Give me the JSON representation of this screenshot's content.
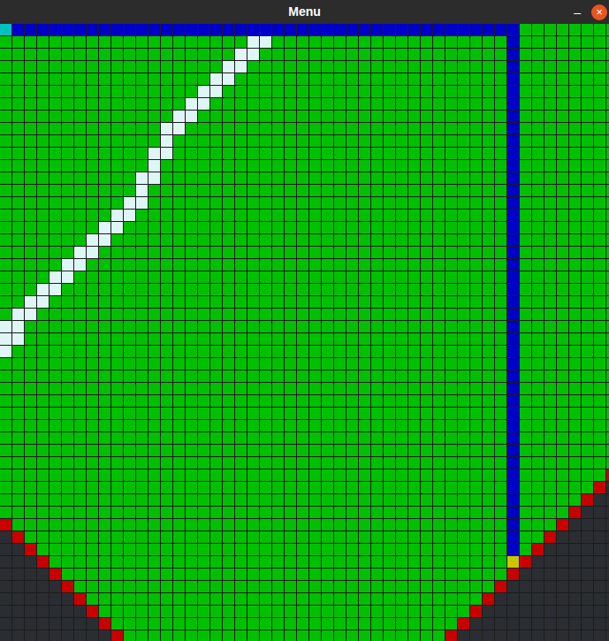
{
  "window": {
    "title": "Menu",
    "controls": [
      "–",
      "×"
    ]
  },
  "cell_kinds": [
    {
      "symbol": "S",
      "kind": "start",
      "color": "#00c0c0"
    },
    {
      "symbol": "E",
      "kind": "goal",
      "color": "#c8c800"
    },
    {
      "symbol": "G",
      "kind": "open",
      "color": "#00c000"
    },
    {
      "symbol": "B",
      "kind": "path",
      "color": "#0000c8"
    },
    {
      "symbol": "W",
      "kind": "wall",
      "color": "#dff6f6"
    },
    {
      "symbol": "R",
      "kind": "edge",
      "color": "#c80000"
    },
    {
      "symbol": "D",
      "kind": "void",
      "color": "#2a2e32"
    }
  ],
  "grid": {
    "rows": [
      [
        [
          "S",
          1
        ],
        [
          "B",
          41
        ],
        [
          "G",
          8
        ]
      ],
      [
        [
          "G",
          20
        ],
        [
          "W",
          2
        ],
        [
          "G",
          19
        ],
        [
          "B",
          1
        ],
        [
          "G",
          8
        ]
      ],
      [
        [
          "G",
          19
        ],
        [
          "W",
          2
        ],
        [
          "G",
          20
        ],
        [
          "B",
          1
        ],
        [
          "G",
          8
        ]
      ],
      [
        [
          "G",
          18
        ],
        [
          "W",
          2
        ],
        [
          "G",
          21
        ],
        [
          "B",
          1
        ],
        [
          "G",
          8
        ]
      ],
      [
        [
          "G",
          17
        ],
        [
          "W",
          2
        ],
        [
          "G",
          22
        ],
        [
          "B",
          1
        ],
        [
          "G",
          8
        ]
      ],
      [
        [
          "G",
          16
        ],
        [
          "W",
          2
        ],
        [
          "G",
          23
        ],
        [
          "B",
          1
        ],
        [
          "G",
          8
        ]
      ],
      [
        [
          "G",
          15
        ],
        [
          "W",
          2
        ],
        [
          "G",
          24
        ],
        [
          "B",
          1
        ],
        [
          "G",
          8
        ]
      ],
      [
        [
          "G",
          14
        ],
        [
          "W",
          2
        ],
        [
          "G",
          25
        ],
        [
          "B",
          1
        ],
        [
          "G",
          8
        ]
      ],
      [
        [
          "G",
          13
        ],
        [
          "W",
          2
        ],
        [
          "G",
          26
        ],
        [
          "B",
          1
        ],
        [
          "G",
          8
        ]
      ],
      [
        [
          "G",
          13
        ],
        [
          "W",
          1
        ],
        [
          "G",
          27
        ],
        [
          "B",
          1
        ],
        [
          "G",
          8
        ]
      ],
      [
        [
          "G",
          12
        ],
        [
          "W",
          2
        ],
        [
          "G",
          27
        ],
        [
          "B",
          1
        ],
        [
          "G",
          8
        ]
      ],
      [
        [
          "G",
          12
        ],
        [
          "W",
          1
        ],
        [
          "G",
          28
        ],
        [
          "B",
          1
        ],
        [
          "G",
          8
        ]
      ],
      [
        [
          "G",
          11
        ],
        [
          "W",
          2
        ],
        [
          "G",
          28
        ],
        [
          "B",
          1
        ],
        [
          "G",
          8
        ]
      ],
      [
        [
          "G",
          11
        ],
        [
          "W",
          1
        ],
        [
          "G",
          29
        ],
        [
          "B",
          1
        ],
        [
          "G",
          8
        ]
      ],
      [
        [
          "G",
          10
        ],
        [
          "W",
          2
        ],
        [
          "G",
          29
        ],
        [
          "B",
          1
        ],
        [
          "G",
          8
        ]
      ],
      [
        [
          "G",
          9
        ],
        [
          "W",
          2
        ],
        [
          "G",
          30
        ],
        [
          "B",
          1
        ],
        [
          "G",
          8
        ]
      ],
      [
        [
          "G",
          8
        ],
        [
          "W",
          2
        ],
        [
          "G",
          31
        ],
        [
          "B",
          1
        ],
        [
          "G",
          8
        ]
      ],
      [
        [
          "G",
          7
        ],
        [
          "W",
          2
        ],
        [
          "G",
          32
        ],
        [
          "B",
          1
        ],
        [
          "G",
          8
        ]
      ],
      [
        [
          "G",
          6
        ],
        [
          "W",
          2
        ],
        [
          "G",
          33
        ],
        [
          "B",
          1
        ],
        [
          "G",
          8
        ]
      ],
      [
        [
          "G",
          5
        ],
        [
          "W",
          2
        ],
        [
          "G",
          34
        ],
        [
          "B",
          1
        ],
        [
          "G",
          8
        ]
      ],
      [
        [
          "G",
          4
        ],
        [
          "W",
          2
        ],
        [
          "G",
          35
        ],
        [
          "B",
          1
        ],
        [
          "G",
          8
        ]
      ],
      [
        [
          "G",
          3
        ],
        [
          "W",
          2
        ],
        [
          "G",
          36
        ],
        [
          "B",
          1
        ],
        [
          "G",
          8
        ]
      ],
      [
        [
          "G",
          2
        ],
        [
          "W",
          2
        ],
        [
          "G",
          37
        ],
        [
          "B",
          1
        ],
        [
          "G",
          8
        ]
      ],
      [
        [
          "G",
          1
        ],
        [
          "W",
          2
        ],
        [
          "G",
          38
        ],
        [
          "B",
          1
        ],
        [
          "G",
          8
        ]
      ],
      [
        [
          "W",
          2
        ],
        [
          "G",
          39
        ],
        [
          "B",
          1
        ],
        [
          "G",
          8
        ]
      ],
      [
        [
          "W",
          2
        ],
        [
          "G",
          39
        ],
        [
          "B",
          1
        ],
        [
          "G",
          8
        ]
      ],
      [
        [
          "W",
          1
        ],
        [
          "G",
          40
        ],
        [
          "B",
          1
        ],
        [
          "G",
          8
        ]
      ],
      [
        [
          "G",
          41
        ],
        [
          "B",
          1
        ],
        [
          "G",
          8
        ]
      ],
      [
        [
          "G",
          41
        ],
        [
          "B",
          1
        ],
        [
          "G",
          8
        ]
      ],
      [
        [
          "G",
          41
        ],
        [
          "B",
          1
        ],
        [
          "G",
          8
        ]
      ],
      [
        [
          "G",
          41
        ],
        [
          "B",
          1
        ],
        [
          "G",
          8
        ]
      ],
      [
        [
          "G",
          41
        ],
        [
          "B",
          1
        ],
        [
          "G",
          8
        ]
      ],
      [
        [
          "G",
          41
        ],
        [
          "B",
          1
        ],
        [
          "G",
          8
        ]
      ],
      [
        [
          "G",
          41
        ],
        [
          "B",
          1
        ],
        [
          "G",
          8
        ]
      ],
      [
        [
          "G",
          41
        ],
        [
          "B",
          1
        ],
        [
          "G",
          8
        ]
      ],
      [
        [
          "G",
          41
        ],
        [
          "B",
          1
        ],
        [
          "G",
          8
        ]
      ],
      [
        [
          "G",
          41
        ],
        [
          "B",
          1
        ],
        [
          "G",
          7
        ],
        [
          "R",
          1
        ]
      ],
      [
        [
          "G",
          41
        ],
        [
          "B",
          1
        ],
        [
          "G",
          6
        ],
        [
          "R",
          1
        ],
        [
          "D",
          1
        ]
      ],
      [
        [
          "G",
          41
        ],
        [
          "B",
          1
        ],
        [
          "G",
          5
        ],
        [
          "R",
          1
        ],
        [
          "D",
          2
        ]
      ],
      [
        [
          "G",
          41
        ],
        [
          "B",
          1
        ],
        [
          "G",
          4
        ],
        [
          "R",
          1
        ],
        [
          "D",
          3
        ]
      ],
      [
        [
          "R",
          1
        ],
        [
          "G",
          40
        ],
        [
          "B",
          1
        ],
        [
          "G",
          3
        ],
        [
          "R",
          1
        ],
        [
          "D",
          4
        ]
      ],
      [
        [
          "D",
          1
        ],
        [
          "R",
          1
        ],
        [
          "G",
          39
        ],
        [
          "B",
          1
        ],
        [
          "G",
          2
        ],
        [
          "R",
          1
        ],
        [
          "D",
          5
        ]
      ],
      [
        [
          "D",
          2
        ],
        [
          "R",
          1
        ],
        [
          "G",
          38
        ],
        [
          "B",
          1
        ],
        [
          "G",
          1
        ],
        [
          "R",
          1
        ],
        [
          "D",
          6
        ]
      ],
      [
        [
          "D",
          3
        ],
        [
          "R",
          1
        ],
        [
          "G",
          37
        ],
        [
          "E",
          1
        ],
        [
          "R",
          1
        ],
        [
          "D",
          7
        ]
      ],
      [
        [
          "D",
          4
        ],
        [
          "R",
          1
        ],
        [
          "G",
          36
        ],
        [
          "R",
          1
        ],
        [
          "D",
          8
        ]
      ],
      [
        [
          "D",
          5
        ],
        [
          "R",
          1
        ],
        [
          "G",
          34
        ],
        [
          "R",
          1
        ],
        [
          "D",
          9
        ]
      ],
      [
        [
          "D",
          6
        ],
        [
          "R",
          1
        ],
        [
          "G",
          32
        ],
        [
          "R",
          1
        ],
        [
          "D",
          10
        ]
      ],
      [
        [
          "D",
          7
        ],
        [
          "R",
          1
        ],
        [
          "G",
          30
        ],
        [
          "R",
          1
        ],
        [
          "D",
          11
        ]
      ],
      [
        [
          "D",
          8
        ],
        [
          "R",
          1
        ],
        [
          "G",
          28
        ],
        [
          "R",
          1
        ],
        [
          "D",
          12
        ]
      ],
      [
        [
          "D",
          9
        ],
        [
          "R",
          1
        ],
        [
          "G",
          26
        ],
        [
          "R",
          1
        ],
        [
          "D",
          13
        ]
      ]
    ]
  }
}
